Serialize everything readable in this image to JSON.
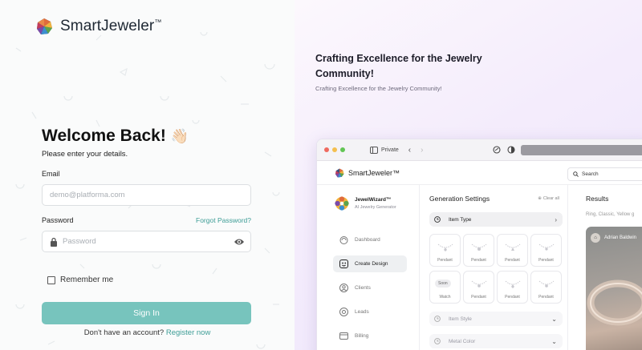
{
  "brand": {
    "name": "SmartJeweler",
    "tm": "™"
  },
  "login": {
    "welcome": "Welcome Back!",
    "welcome_emoji": "👋🏻",
    "subtitle": "Please enter your details.",
    "email_label": "Email",
    "email_placeholder": "demo@platforma.com",
    "password_label": "Password",
    "password_placeholder": "Password",
    "forgot": "Forgot Password?",
    "remember": "Remember me",
    "signin": "Sign In",
    "no_account": "Don't have an account?",
    "register": "Register now"
  },
  "hero": {
    "title": "Crafting Excellence for the Jewelry Community!",
    "subtitle": "Crafting Excellence for the Jewelry Community!"
  },
  "browser": {
    "private": "Private"
  },
  "app": {
    "brand": "SmartJeweler™",
    "search": "Search",
    "sidebar": {
      "name": "JewelWizard™",
      "sub": "AI Jewelry Generator",
      "items": [
        "Dashboard",
        "Create Design",
        "Clients",
        "Leads",
        "Billing"
      ]
    },
    "generation": {
      "title": "Generation Settings",
      "clear": "Clear all",
      "item_type": "Item Type",
      "item_style": "Item Style",
      "metal_color": "Metal Color",
      "cells": [
        "Pendant",
        "Pendant",
        "Pendant",
        "Pendant",
        "Watch",
        "Pendant",
        "Pendant",
        "Pendant"
      ],
      "soon": "Soon"
    },
    "results": {
      "title": "Results",
      "tags": "Ring, Classic, Yellow g",
      "user": "Adrian Baldwin"
    }
  },
  "colors": {
    "accent": "#77c4bd",
    "link": "#3d9d96"
  }
}
